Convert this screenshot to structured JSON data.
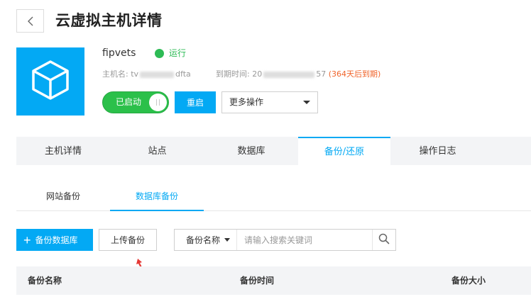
{
  "header": {
    "title": "云虚拟主机详情"
  },
  "host": {
    "name": "fipvets",
    "status": "运行",
    "hostname_label": "主机名:",
    "hostname_prefix": "tv",
    "hostname_suffix": "dfta",
    "expiry_label": "到期时间:",
    "expiry_prefix": "20",
    "expiry_suffix": "57",
    "remaining": "(364天后到期)"
  },
  "actions": {
    "toggle_label": "已启动",
    "restart_label": "重启",
    "more_label": "更多操作"
  },
  "tabs": [
    {
      "label": "主机详情",
      "active": false
    },
    {
      "label": "站点",
      "active": false
    },
    {
      "label": "数据库",
      "active": false
    },
    {
      "label": "备份/还原",
      "active": true
    },
    {
      "label": "操作日志",
      "active": false
    }
  ],
  "subtabs": [
    {
      "label": "网站备份",
      "active": false
    },
    {
      "label": "数据库备份",
      "active": true
    }
  ],
  "toolbar": {
    "backup_db_label": "备份数据库",
    "upload_label": "上传备份",
    "search_field": "备份名称",
    "search_placeholder": "请输入搜索关键词"
  },
  "table": {
    "columns": [
      "备份名称",
      "备份时间",
      "备份大小"
    ]
  },
  "colors": {
    "accent": "#03a9f4",
    "running": "#2dbb55",
    "toggle_on": "#2bc04a",
    "remaining": "#f0642b",
    "annotation_arrow": "#e53935"
  },
  "icons": {
    "back": "chevron-left-icon",
    "host": "cube-icon",
    "search": "search-icon",
    "add": "plus-icon"
  }
}
